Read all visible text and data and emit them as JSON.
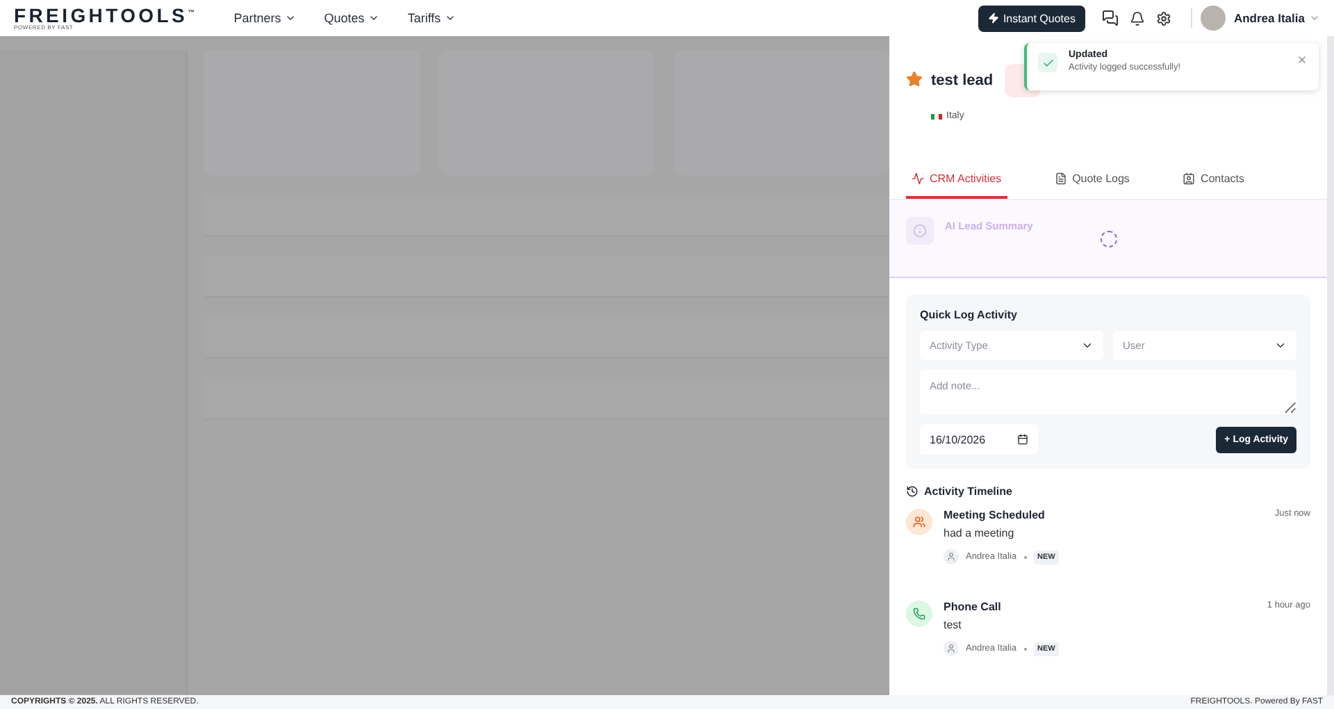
{
  "header": {
    "logo": {
      "brand": "FREIGHTOOLS",
      "mark": "™",
      "tagline": "POWERED BY FAST"
    },
    "nav": [
      {
        "label": "Partners"
      },
      {
        "label": "Quotes"
      },
      {
        "label": "Tariffs"
      }
    ],
    "instant_quotes": "Instant Quotes",
    "user": {
      "name": "Andrea Italia"
    }
  },
  "lead": {
    "name": "test lead",
    "country": "Italy"
  },
  "toast": {
    "title": "Updated",
    "message": "Activity logged successfully!"
  },
  "tabs": [
    {
      "kind": "activities",
      "label": "CRM Activities",
      "selected": true
    },
    {
      "kind": "quotes",
      "label": "Quote Logs",
      "selected": false
    },
    {
      "kind": "contacts",
      "label": "Contacts",
      "selected": false
    }
  ],
  "ai_summary": {
    "title": "AI Lead Summary"
  },
  "quick_log": {
    "title": "Quick Log Activity",
    "activity_type": {
      "placeholder": "Activity Type"
    },
    "user": {
      "placeholder": "User"
    },
    "note": {
      "placeholder": "Add note..."
    },
    "date": "16/10/2026",
    "button": "+ Log Activity"
  },
  "timeline": {
    "title": "Activity Timeline",
    "items": [
      {
        "kind": "meeting",
        "title": "Meeting Scheduled",
        "note": "had a meeting",
        "time": "Just now",
        "user": "Andrea Italia",
        "badge": "NEW"
      },
      {
        "kind": "call",
        "title": "Phone Call",
        "note": "test",
        "time": "1 hour ago",
        "user": "Andrea Italia",
        "badge": "NEW"
      }
    ]
  },
  "footer": {
    "left": "**COPYRIGHTS © 2025.** ALL RIGHTS RESERVED.",
    "right": "FREIGHTOOLS. Powered By FAST"
  }
}
